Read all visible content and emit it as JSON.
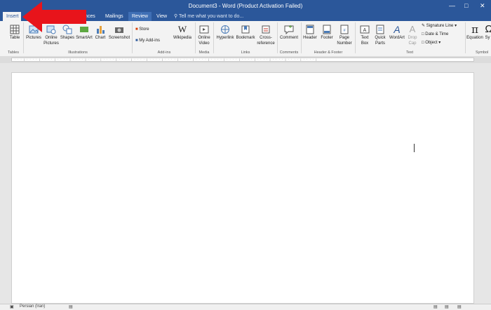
{
  "window": {
    "title": "Document3 - Word (Product Activation Failed)"
  },
  "tabs": [
    {
      "label": "Insert",
      "active": true
    },
    {
      "label": "nces"
    },
    {
      "label": "Mailings"
    },
    {
      "label": "Review",
      "highlight": true
    },
    {
      "label": "View"
    }
  ],
  "tell_me": {
    "placeholder": "Tell me what you want to do..."
  },
  "ribbon": {
    "tables": {
      "table": "Table",
      "group": "Tables"
    },
    "illustrations": {
      "pictures": "Pictures",
      "online_pictures_1": "Online",
      "online_pictures_2": "Pictures",
      "shapes": "Shapes",
      "smartart": "SmartArt",
      "chart": "Chart",
      "screenshot": "Screenshot",
      "group": "Illustrations"
    },
    "addins": {
      "store": "Store",
      "my_addins": "My Add-ins",
      "wikipedia": "Wikipedia",
      "group": "Add-ins"
    },
    "media": {
      "online_video_1": "Online",
      "online_video_2": "Video",
      "group": "Media"
    },
    "links": {
      "hyperlink": "Hyperlink",
      "bookmark": "Bookmark",
      "cross_ref_1": "Cross-",
      "cross_ref_2": "reference",
      "group": "Links"
    },
    "comments": {
      "comment": "Comment",
      "group": "Comments"
    },
    "header_footer": {
      "header": "Header",
      "footer": "Footer",
      "page_number_1": "Page",
      "page_number_2": "Number",
      "group": "Header & Footer"
    },
    "text": {
      "text_box_1": "Text",
      "text_box_2": "Box",
      "quick_parts_1": "Quick",
      "quick_parts_2": "Parts",
      "wordart": "WordArt",
      "drop_cap_1": "Drop",
      "drop_cap_2": "Cap",
      "signature_line": "Signature Line",
      "date_time": "Date & Time",
      "object": "Object",
      "group": "Text"
    },
    "symbols": {
      "equation": "Equation",
      "symbol": "Sy",
      "group": "Symbol"
    }
  },
  "status": {
    "language": "Persian (Iran)"
  },
  "colors": {
    "brand": "#2b579a",
    "arrow": "#e8141b"
  }
}
